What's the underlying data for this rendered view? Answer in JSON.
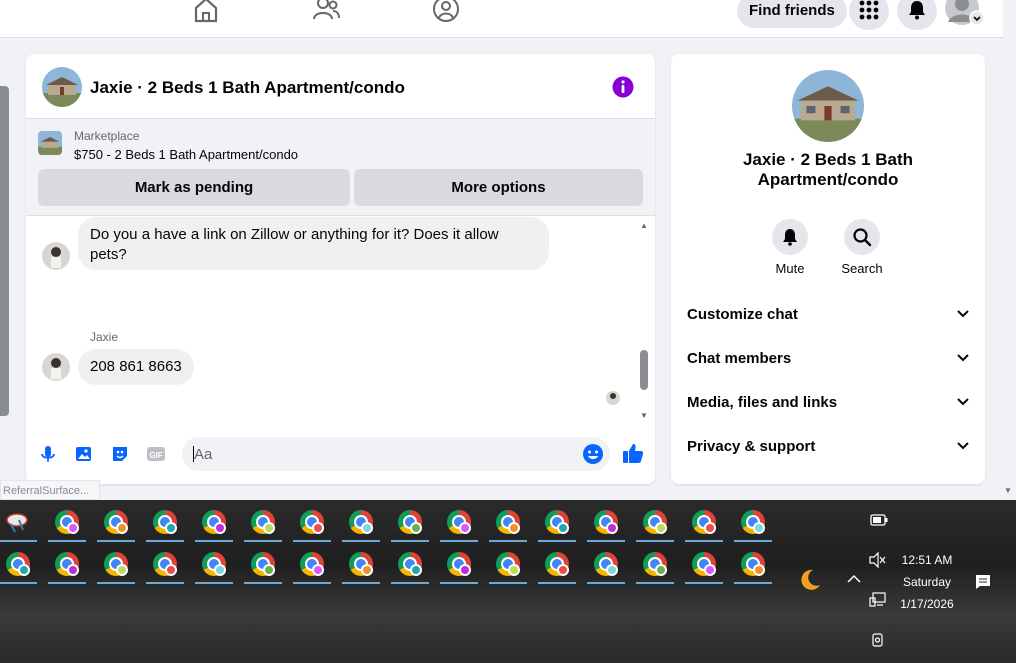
{
  "chat": {
    "title": "Jaxie · 2 Beds 1 Bath Apartment/condo",
    "marketplace_label": "Marketplace",
    "listing_price": "$750 - 2 Beds 1 Bath Apartment/condo",
    "mark_pending": "Mark as pending",
    "more_options": "More options",
    "messages": [
      {
        "text": "Do you a have a link on Zillow or anything for it? Does it allow pets?"
      },
      {
        "sender": "Jaxie",
        "text": "208 861 8663"
      }
    ],
    "composer_placeholder": "Aa"
  },
  "nav": {
    "find_friends": "Find friends"
  },
  "side": {
    "title": "Jaxie · 2 Beds 1 Bath Apartment/condo",
    "mute": "Mute",
    "search": "Search",
    "rows": [
      "Customize chat",
      "Chat members",
      "Media, files and links",
      "Privacy & support"
    ]
  },
  "tooltip": "ReferralSurface...",
  "taskbar": {
    "time": "12:51 AM",
    "day": "Saturday",
    "date": "1/17/2026"
  },
  "colors": {
    "accent": "#0866ff",
    "info_purple": "#8a00d4",
    "badge_red": "#e41e3f"
  }
}
